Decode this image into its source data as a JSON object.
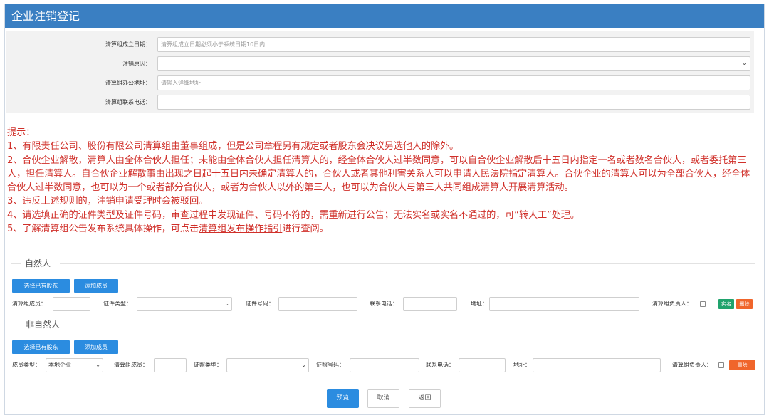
{
  "header": {
    "title": "企业注销登记"
  },
  "form": {
    "date_label": "清算组成立日期：",
    "date_placeholder": "清算组成立日期必须小于系统日期10日内",
    "reason_label": "注销原因：",
    "reason_value": "",
    "address_label": "清算组办公地址：",
    "address_placeholder": "请输入详细地址",
    "phone_label": "清算组联系电话：",
    "phone_value": ""
  },
  "tips": {
    "title": "提示：",
    "item1": "1、有限责任公司、股份有限公司清算组由董事组成，但是公司章程另有规定或者股东会决议另选他人的除外。",
    "item2": "2、合伙企业解散，清算人由全体合伙人担任；未能由全体合伙人担任清算人的，经全体合伙人过半数同意，可以自合伙企业解散后十五日内指定一名或者数名合伙人，或者委托第三人，担任清算人。自合伙企业解散事由出现之日起十五日内未确定清算人的，合伙人或者其他利害关系人可以申请人民法院指定清算人。合伙企业的清算人可以为全部合伙人，经全体合伙人过半数同意，也可以为一个或者部分合伙人，或者为合伙人以外的第三人，也可以为合伙人与第三人共同组成清算人开展清算活动。",
    "item3": "3、违反上述规则的，注销申请受理时会被驳回。",
    "item4": "4、请选填正确的证件类型及证件号码，审查过程中发现证件、号码不符的，需重新进行公告；无法实名或实名不通过的，可“转人工”处理。",
    "item5_prefix": "5、了解清算组公告发布系统具体操作，可点击",
    "item5_link": "清算组发布操作指引",
    "item5_suffix": "进行查阅。"
  },
  "natural": {
    "section_title": "自然人",
    "select_shareholder_btn": "选择已有股东",
    "add_member_btn": "添加成员",
    "member_label": "清算组成员：",
    "member_value": "",
    "cert_type_label": "证件类型：",
    "cert_type_value": "",
    "cert_no_label": "证件号码：",
    "cert_no_value": "",
    "phone_label": "联系电话：",
    "phone_value": "",
    "address_label": "地址：",
    "address_value": "",
    "leader_label": "清算组负责人：",
    "realname_btn": "实名",
    "delete_btn": "删除"
  },
  "non_natural": {
    "section_title": "非自然人",
    "select_shareholder_btn": "选择已有股东",
    "add_member_btn": "添加成员",
    "member_type_label": "成员类型：",
    "member_type_value": "本地企业",
    "member_label": "清算组成员：",
    "member_value": "",
    "cert_type_label": "证照类型：",
    "cert_type_value": "",
    "cert_no_label": "证照号码：",
    "cert_no_value": "",
    "phone_label": "联系电话：",
    "phone_value": "",
    "address_label": "地址：",
    "address_value": "",
    "leader_label": "清算组负责人：",
    "delete_btn": "删除"
  },
  "footer": {
    "preview_btn": "预览",
    "cancel_btn": "取消",
    "back_btn": "返回"
  },
  "colors": {
    "header_bg": "#3a7fc2",
    "primary_button": "#2b8ce0",
    "tip_text": "#d0302a",
    "realname_button": "#20a36d",
    "delete_button": "#f0652b"
  }
}
